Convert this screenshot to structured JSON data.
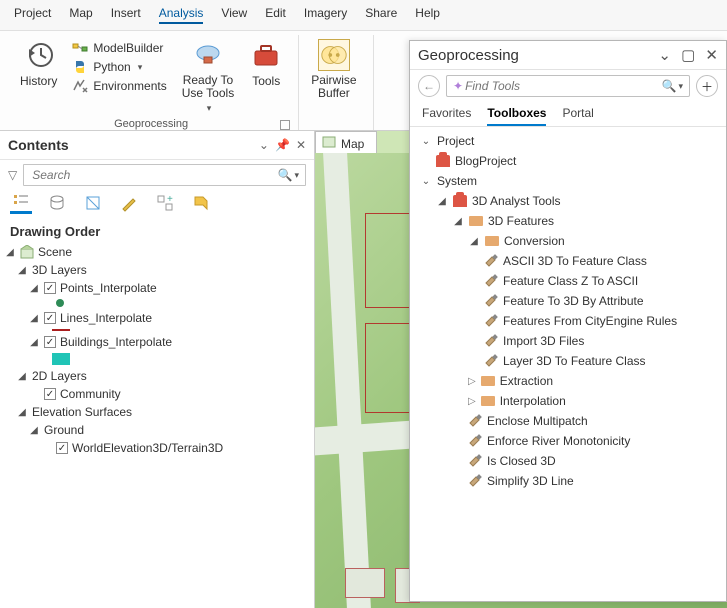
{
  "menubar": [
    "Project",
    "Map",
    "Insert",
    "Analysis",
    "View",
    "Edit",
    "Imagery",
    "Share",
    "Help"
  ],
  "menubar_active": "Analysis",
  "ribbon": {
    "history": "History",
    "modelbuilder": "ModelBuilder",
    "python": "Python",
    "environments": "Environments",
    "ready_to_use": "Ready To\nUse Tools",
    "tools": "Tools",
    "group1_label": "Geoprocessing",
    "pairwise": "Pairwise\nBuffer"
  },
  "contents": {
    "title": "Contents",
    "search_placeholder": "Search",
    "section": "Drawing Order",
    "scene": "Scene",
    "layers3d": "3D Layers",
    "points": "Points_Interpolate",
    "lines": "Lines_Interpolate",
    "buildings": "Buildings_Interpolate",
    "layers2d": "2D Layers",
    "community": "Community",
    "elevation": "Elevation Surfaces",
    "ground": "Ground",
    "terrain": "WorldElevation3D/Terrain3D",
    "colors": {
      "points": "#2e8b57",
      "lines": "#aa1e1e",
      "buildings": "#20c4b6"
    }
  },
  "map_tab": "Map",
  "gp": {
    "title": "Geoprocessing",
    "search_placeholder": "Find Tools",
    "tabs": [
      "Favorites",
      "Toolboxes",
      "Portal"
    ],
    "tabs_active": "Toolboxes",
    "project": "Project",
    "blogproject": "BlogProject",
    "system": "System",
    "analyst": "3D Analyst Tools",
    "features3d": "3D Features",
    "conversion": "Conversion",
    "conversion_tools": [
      "ASCII 3D To Feature Class",
      "Feature Class Z To ASCII",
      "Feature To 3D By Attribute",
      "Features From CityEngine Rules",
      "Import 3D Files",
      "Layer 3D To Feature Class"
    ],
    "extraction": "Extraction",
    "interpolation": "Interpolation",
    "misc_tools": [
      "Enclose Multipatch",
      "Enforce River Monotonicity",
      "Is Closed 3D",
      "Simplify 3D Line"
    ]
  }
}
